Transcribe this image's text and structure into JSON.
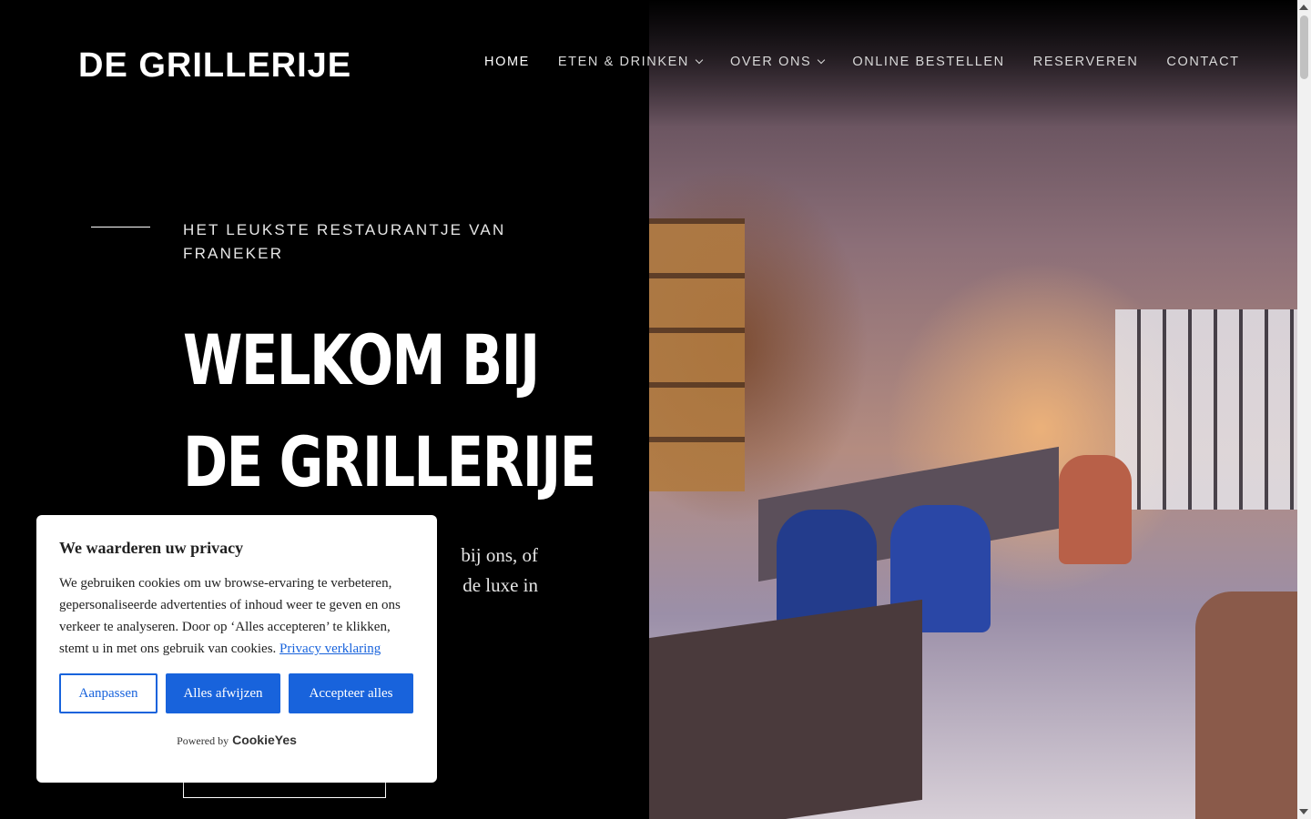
{
  "header": {
    "logo": "DE GRILLERIJE",
    "nav": [
      {
        "label": "HOME",
        "active": true,
        "dropdown": false
      },
      {
        "label": "ETEN & DRINKEN",
        "active": false,
        "dropdown": true
      },
      {
        "label": "OVER ONS",
        "active": false,
        "dropdown": true
      },
      {
        "label": "ONLINE BESTELLEN",
        "active": false,
        "dropdown": false
      },
      {
        "label": "RESERVEREN",
        "active": false,
        "dropdown": false
      },
      {
        "label": "CONTACT",
        "active": false,
        "dropdown": false
      }
    ]
  },
  "hero": {
    "eyebrow": "HET LEUKSTE RESTAURANTJE VAN FRANEKER",
    "headline_line1": "WELKOM BIJ",
    "headline_line2": "DE GRILLERIJE",
    "intro_line1": "bij ons, of",
    "intro_line2": "de luxe in"
  },
  "cookie_banner": {
    "title": "We waarderen uw privacy",
    "text": "We gebruiken cookies om uw browse-ervaring te verbeteren, gepersonaliseerde advertenties of inhoud weer te geven en ons verkeer te analyseren. Door op ‘Alles accepteren’ te klikken, stemt u in met ons gebruik van cookies.",
    "privacy_link": "Privacy verklaring",
    "customize_label": "Aanpassen",
    "reject_label": "Alles afwijzen",
    "accept_label": "Accepteer alles",
    "powered_by": "Powered by",
    "brand": "CookieYes"
  },
  "colors": {
    "background": "#000000",
    "accent": "#1863dc",
    "text": "#ffffff"
  }
}
